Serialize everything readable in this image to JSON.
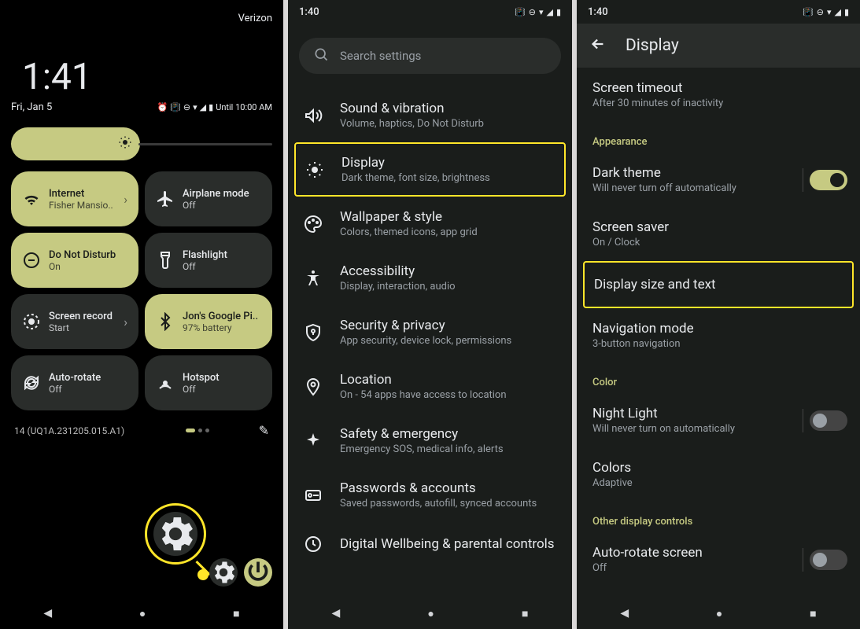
{
  "panel1": {
    "time": "1:41",
    "date": "Fri, Jan 5",
    "carrier": "Verizon",
    "until_text": "Until 10:00 AM",
    "tiles": [
      {
        "title": "Internet",
        "sub": "Fisher Mansio..",
        "state": "on",
        "icon": "wifi",
        "chev": true
      },
      {
        "title": "Airplane mode",
        "sub": "Off",
        "state": "off",
        "icon": "airplane"
      },
      {
        "title": "Do Not Disturb",
        "sub": "On",
        "state": "on",
        "icon": "dnd"
      },
      {
        "title": "Flashlight",
        "sub": "Off",
        "state": "off",
        "icon": "flashlight"
      },
      {
        "title": "Screen record",
        "sub": "Start",
        "state": "off",
        "icon": "record",
        "chev": true
      },
      {
        "title": "Jon's Google Pi..",
        "sub": "97% battery",
        "state": "on",
        "icon": "bluetooth"
      },
      {
        "title": "Auto-rotate",
        "sub": "Off",
        "state": "off",
        "icon": "rotate"
      },
      {
        "title": "Hotspot",
        "sub": "Off",
        "state": "off",
        "icon": "hotspot"
      }
    ],
    "build": "14 (UQ1A.231205.015.A1)"
  },
  "panel2": {
    "status_time": "1:40",
    "search_placeholder": "Search settings",
    "items": [
      {
        "title": "Sound & vibration",
        "sub": "Volume, haptics, Do Not Disturb",
        "icon": "volume"
      },
      {
        "title": "Display",
        "sub": "Dark theme, font size, brightness",
        "icon": "brightness",
        "highlighted": true
      },
      {
        "title": "Wallpaper & style",
        "sub": "Colors, themed icons, app grid",
        "icon": "palette"
      },
      {
        "title": "Accessibility",
        "sub": "Display, interaction, audio",
        "icon": "accessibility"
      },
      {
        "title": "Security & privacy",
        "sub": "App security, device lock, permissions",
        "icon": "shield"
      },
      {
        "title": "Location",
        "sub": "On - 54 apps have access to location",
        "icon": "location"
      },
      {
        "title": "Safety & emergency",
        "sub": "Emergency SOS, medical info, alerts",
        "icon": "emergency"
      },
      {
        "title": "Passwords & accounts",
        "sub": "Saved passwords, autofill, synced accounts",
        "icon": "key"
      },
      {
        "title": "Digital Wellbeing & parental controls",
        "sub": "",
        "icon": "wellbeing"
      }
    ]
  },
  "panel3": {
    "status_time": "1:40",
    "header": "Display",
    "top_items": [
      {
        "title": "Screen timeout",
        "sub": "After 30 minutes of inactivity"
      }
    ],
    "sections": [
      {
        "label": "Appearance",
        "items": [
          {
            "title": "Dark theme",
            "sub": "Will never turn off automatically",
            "toggle": "on"
          },
          {
            "title": "Screen saver",
            "sub": "On / Clock"
          },
          {
            "title": "Display size and text",
            "highlighted": true
          },
          {
            "title": "Navigation mode",
            "sub": "3-button navigation"
          }
        ]
      },
      {
        "label": "Color",
        "items": [
          {
            "title": "Night Light",
            "sub": "Will never turn on automatically",
            "toggle": "off"
          },
          {
            "title": "Colors",
            "sub": "Adaptive"
          }
        ]
      },
      {
        "label": "Other display controls",
        "items": [
          {
            "title": "Auto-rotate screen",
            "sub": "Off",
            "toggle": "off"
          }
        ]
      }
    ]
  }
}
